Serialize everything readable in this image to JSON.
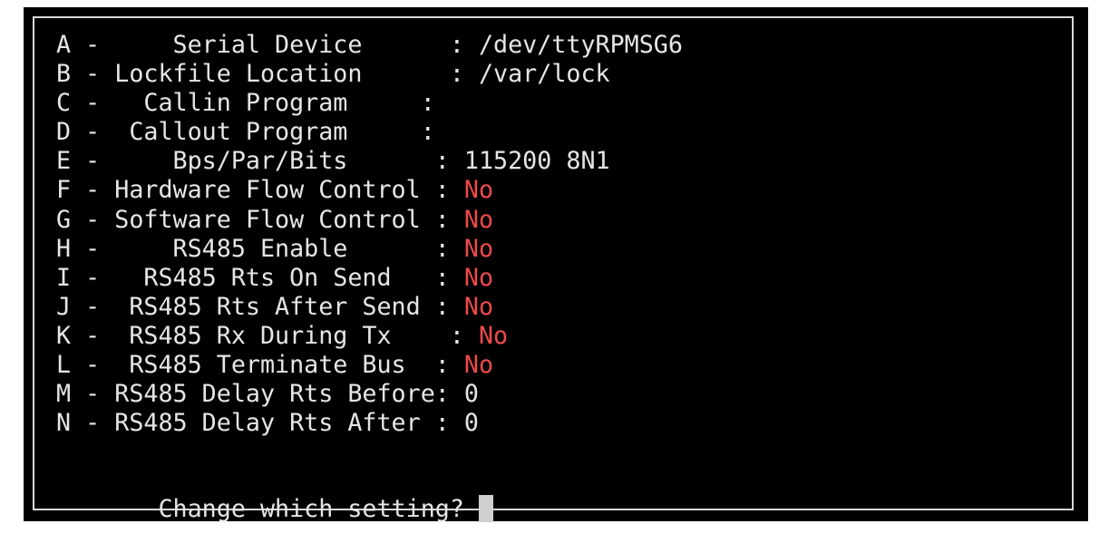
{
  "menu": {
    "items": [
      {
        "key": "A",
        "label": "Serial Device      ",
        "value": "/dev/ttyRPMSG6",
        "red": false
      },
      {
        "key": "B",
        "label": "Lockfile Location  ",
        "value": "/var/lock",
        "red": false
      },
      {
        "key": "C",
        "label": "Callin Program     ",
        "value": "",
        "red": false
      },
      {
        "key": "D",
        "label": "Callout Program    ",
        "value": "",
        "red": false
      },
      {
        "key": "E",
        "label": "Bps/Par/Bits       ",
        "value": "115200 8N1",
        "red": false
      },
      {
        "key": "F",
        "label": "Hardware Flow Control",
        "value": "No",
        "red": true
      },
      {
        "key": "G",
        "label": "Software Flow Control",
        "value": "No",
        "red": true
      },
      {
        "key": "H",
        "label": "RS485 Enable       ",
        "value": "No",
        "red": true
      },
      {
        "key": "I",
        "label": "RS485 Rts On Send  ",
        "value": "No",
        "red": true
      },
      {
        "key": "J",
        "label": "RS485 Rts After Send",
        "value": "No",
        "red": true
      },
      {
        "key": "K",
        "label": "RS485 Rx During Tx ",
        "value": "No",
        "red": true
      },
      {
        "key": "L",
        "label": "RS485 Terminate Bus",
        "value": "No",
        "red": true
      },
      {
        "key": "M",
        "label": "RS485 Delay Rts Before",
        "value": "0",
        "red": false
      },
      {
        "key": "N",
        "label": "RS485 Delay Rts After",
        "value": "0",
        "red": false
      }
    ],
    "prefixes": [
      "A -     ",
      "B - ",
      "C -   ",
      "D -  ",
      "E -     ",
      "F - ",
      "G - ",
      "H -     ",
      "I -   ",
      "J -  ",
      "K -  ",
      "L -  ",
      "M - ",
      "N - "
    ],
    "separators": [
      "      : ",
      "      : ",
      "     : ",
      "     : ",
      "      : ",
      " : ",
      " : ",
      "      : ",
      "   : ",
      " : ",
      "    : ",
      "  : ",
      ": ",
      " : "
    ],
    "labels": [
      "Serial Device",
      "Lockfile Location",
      "Callin Program",
      "Callout Program",
      "Bps/Par/Bits",
      "Hardware Flow Control",
      "Software Flow Control",
      "RS485 Enable",
      "RS485 Rts On Send",
      "RS485 Rts After Send",
      "RS485 Rx During Tx",
      "RS485 Terminate Bus",
      "RS485 Delay Rts Before",
      "RS485 Delay Rts After"
    ]
  },
  "prompt": {
    "text": "   Change which setting? "
  },
  "colors": {
    "background": "#000000",
    "text": "#e6e6e6",
    "no_value": "#ee4a4a",
    "border": "#d8d8d8"
  }
}
